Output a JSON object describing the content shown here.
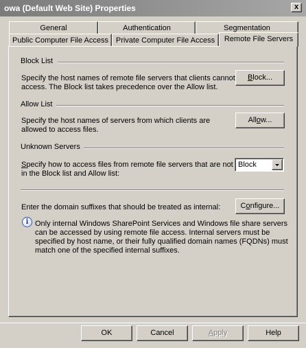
{
  "window": {
    "title": "owa (Default Web Site) Properties",
    "close_label": "x"
  },
  "tabs_row1": [
    {
      "label": "General"
    },
    {
      "label": "Authentication"
    },
    {
      "label": "Segmentation"
    }
  ],
  "tabs_row2": [
    {
      "label": "Public Computer File Access"
    },
    {
      "label": "Private Computer File Access"
    },
    {
      "label": "Remote File Servers",
      "active": true
    }
  ],
  "block": {
    "title": "Block List",
    "desc": "Specify the host names of remote file servers that clients cannot access. The Block list takes precedence over the Allow list.",
    "button": {
      "u": "B",
      "rest": "lock..."
    }
  },
  "allow": {
    "title": "Allow List",
    "desc": "Specify the host names of servers from which clients are allowed to access files.",
    "button": {
      "pre": "All",
      "u": "o",
      "post": "w..."
    }
  },
  "unknown": {
    "title": "Unknown Servers",
    "desc_u": "S",
    "desc_rest": "pecify how to access files from remote file servers that are not in the Block list and Allow list:",
    "select_value": "Block"
  },
  "internal": {
    "label": "Enter the domain suffixes that should be treated as internal:",
    "button": {
      "pre": "C",
      "u": "o",
      "post": "nfigure..."
    }
  },
  "info": {
    "icon": "info-icon",
    "text": "Only internal Windows SharePoint Services and Windows file share servers can be accessed by using remote file access. Internal servers must be specified by host name, or their fully qualified domain names (FQDNs) must match one of the specified internal suffixes."
  },
  "footer": {
    "ok": "OK",
    "cancel": "Cancel",
    "apply": {
      "u": "A",
      "rest": "pply"
    },
    "help": "Help"
  }
}
